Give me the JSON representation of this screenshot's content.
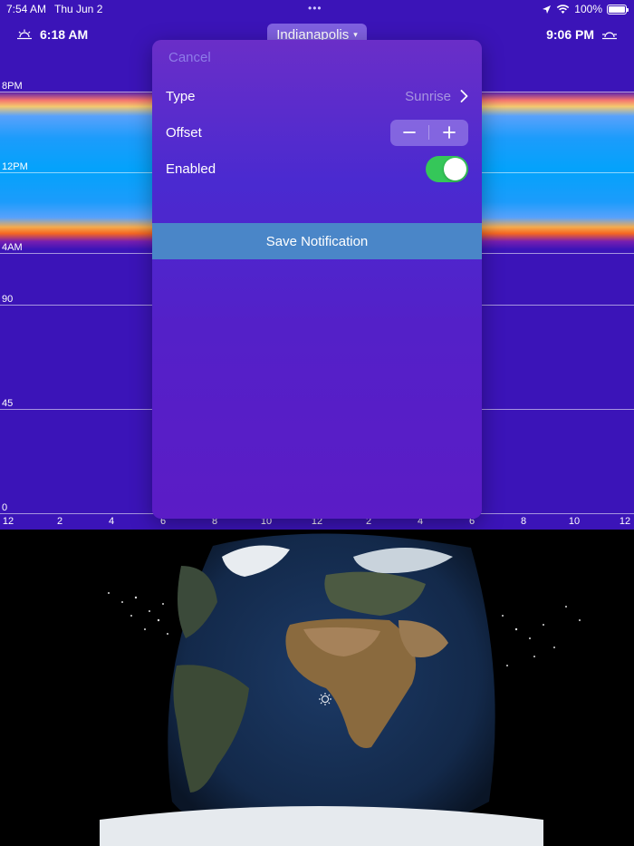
{
  "status_bar": {
    "time": "7:54 AM",
    "date": "Thu Jun 2",
    "dots": "•••",
    "battery": "100%"
  },
  "header": {
    "sunrise": "6:18 AM",
    "sunset": "9:06 PM",
    "location": "Indianapolis",
    "location_caret": "▾"
  },
  "chart": {
    "y_labels": [
      "8PM",
      "12PM",
      "4AM",
      "90",
      "45",
      "0"
    ],
    "x_labels": [
      "12",
      "2",
      "4",
      "6",
      "8",
      "10",
      "12",
      "2",
      "4",
      "6",
      "8",
      "10",
      "12"
    ]
  },
  "popover": {
    "cancel": "Cancel",
    "type_label": "Type",
    "type_value": "Sunrise",
    "offset_label": "Offset",
    "enabled_label": "Enabled",
    "enabled": true,
    "save": "Save Notification"
  },
  "colors": {
    "sky": "#3b14b8",
    "toggle_on": "#35c759",
    "save_button": "#4a86c8",
    "cancel": "#8e7ce8"
  },
  "icons": {
    "sunrise": "sunrise-icon",
    "sunset": "sunset-icon",
    "sun": "sun-position-icon"
  }
}
